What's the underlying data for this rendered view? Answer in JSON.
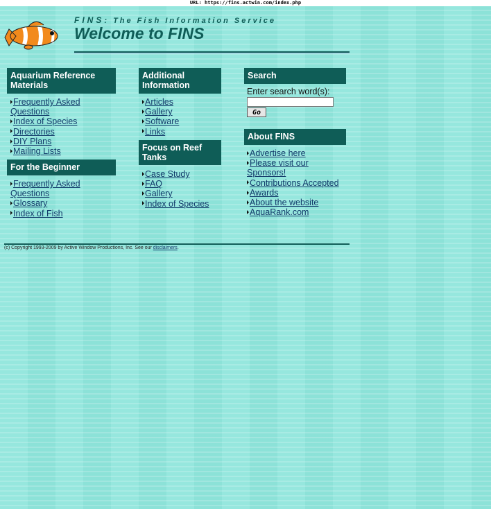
{
  "url_bar": {
    "text": "URL: https://fins.actwin.com/index.php"
  },
  "header": {
    "tagline_name": "FINS",
    "tagline_rest": ": The Fish Information Service",
    "title": "Welcome to FINS",
    "logo_icon": "clownfish-icon"
  },
  "aquarium": {
    "heading": "Aquarium Reference Materials",
    "items": [
      "Frequently Asked Questions",
      "Index of Species",
      "Directories",
      "DIY Plans",
      "Mailing Lists"
    ]
  },
  "beginner": {
    "heading": "For the Beginner",
    "items": [
      "Frequently Asked Questions",
      "Glossary",
      "Index of Fish"
    ]
  },
  "additional": {
    "heading": "Additional Information",
    "items": [
      "Articles",
      "Gallery",
      "Software",
      "Links"
    ]
  },
  "reef": {
    "heading": "Focus on Reef Tanks",
    "items": [
      "Case Study",
      "FAQ",
      "Gallery",
      "Index of Species"
    ]
  },
  "search": {
    "heading": "Search",
    "label": "Enter search word(s):",
    "value": "",
    "button_label": "Go"
  },
  "about": {
    "heading": "About FINS",
    "items": [
      "Advertise here",
      "Please visit our Sponsors!",
      "Contributions Accepted",
      "Awards",
      "About the website",
      "AquaRank.com"
    ]
  },
  "footer": {
    "text": "(c) Copyright 1993-2009 by Active Window Productions, Inc. See our",
    "link": "disclaimers",
    "suffix": "."
  },
  "colors": {
    "accent": "#0f5d57",
    "background": "#8fe6dc",
    "link": "#123a6a"
  }
}
